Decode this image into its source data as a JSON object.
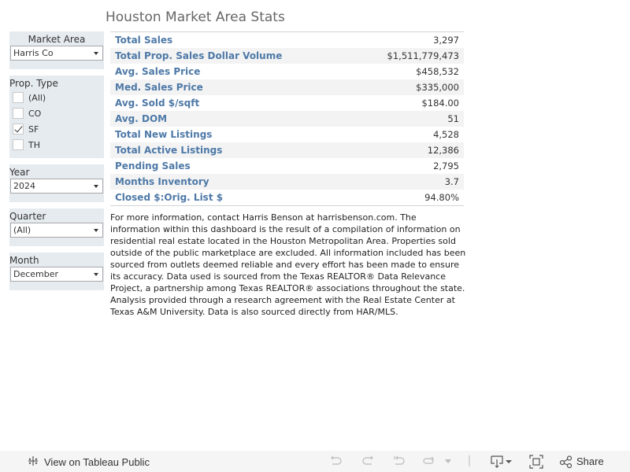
{
  "page": {
    "title": "Houston Market Area Stats"
  },
  "filters": {
    "market_area": {
      "label": "Market Area",
      "value": "Harris Co"
    },
    "prop_type": {
      "label": "Prop. Type",
      "options": [
        {
          "label": "(All)",
          "checked": false
        },
        {
          "label": "CO",
          "checked": false
        },
        {
          "label": "SF",
          "checked": true
        },
        {
          "label": "TH",
          "checked": false
        }
      ]
    },
    "year": {
      "label": "Year",
      "value": "2024"
    },
    "quarter": {
      "label": "Quarter",
      "value": "(All)"
    },
    "month": {
      "label": "Month",
      "value": "December"
    }
  },
  "stats": [
    {
      "label": "Total Sales",
      "value": "3,297"
    },
    {
      "label": "Total Prop. Sales Dollar Volume",
      "value": "$1,511,779,473"
    },
    {
      "label": "Avg. Sales Price",
      "value": "$458,532"
    },
    {
      "label": "Med. Sales Price",
      "value": "$335,000"
    },
    {
      "label": "Avg. Sold $/sqft",
      "value": "$184.00"
    },
    {
      "label": "Avg. DOM",
      "value": "51"
    },
    {
      "label": "Total New Listings",
      "value": "4,528"
    },
    {
      "label": "Total Active Listings",
      "value": "12,386"
    },
    {
      "label": "Pending Sales",
      "value": "2,795"
    },
    {
      "label": "Months Inventory",
      "value": "3.7"
    },
    {
      "label": "Closed $:Orig. List $",
      "value": "94.80%"
    }
  ],
  "description": "For more information, contact Harris Benson at harrisbenson.com. The information within this dashboard is the result of a compilation of information on residential real estate located in the Houston Metropolitan Area. Properties sold outside of the public marketplace are excluded. All information included has been sourced from outlets deemed reliable and every effort has been made to ensure its accuracy. Data used is sourced from the Texas REALTOR® Data Relevance Project, a partnership among Texas REALTOR® associations throughout the state. Analysis provided through a research agreement with the Real Estate Center at Texas A&M University. Data is also sourced directly from HAR/MLS.",
  "toolbar": {
    "view_on_tableau": "View on Tableau Public",
    "share": "Share",
    "icons": [
      "tableau-logo-icon",
      "undo-icon",
      "redo-icon",
      "revert-icon",
      "refresh-icon",
      "dropdown-caret-icon",
      "download-icon",
      "fullscreen-icon",
      "share-icon"
    ]
  }
}
